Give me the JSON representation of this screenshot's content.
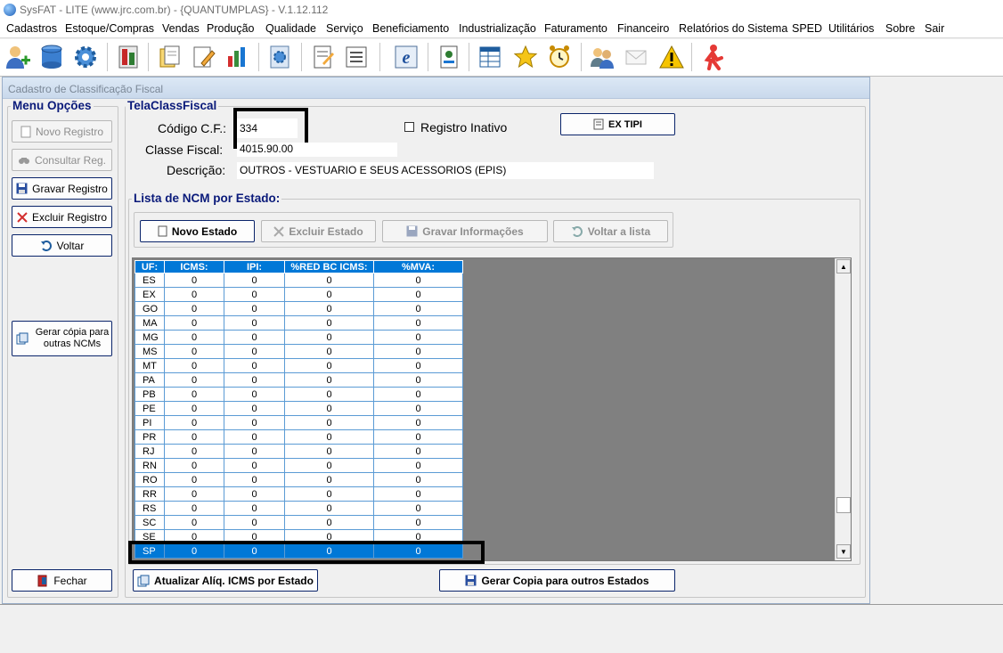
{
  "window": {
    "title": "SysFAT - LITE (www.jrc.com.br) - {QUANTUMPLAS} - V.1.12.112"
  },
  "menu": [
    "Cadastros",
    "Estoque/Compras",
    "Vendas",
    "Produção",
    "Qualidade",
    "Serviço",
    "Beneficiamento",
    "Industrialização",
    "Faturamento",
    "Financeiro",
    "Relatórios do Sistema",
    "SPED",
    "Utilitários",
    "Sobre",
    "Sair"
  ],
  "toolbar": [
    "users-add-icon",
    "database-icon",
    "gear-icon",
    "calculator-icon",
    "documents-icon",
    "edit-doc-icon",
    "chart-icon",
    "settings-doc-icon",
    "notes-icon",
    "list-icon",
    "nfe-icon",
    "report-icon",
    "spreadsheet-icon",
    "star-icon",
    "alarm-icon",
    "chat-users-icon",
    "mail-icon",
    "warning-icon",
    "exit-icon"
  ],
  "child": {
    "title": "Cadastro de Classificação Fiscal"
  },
  "menu_opcoes": {
    "label": "Menu Opções",
    "novo": "Novo Registro",
    "consultar": "Consultar Reg.",
    "gravar": "Gravar Registro",
    "excluir": "Excluir Registro",
    "voltar": "Voltar",
    "gerar_copia_1": "Gerar cópia para",
    "gerar_copia_2": "outras NCMs",
    "fechar": "Fechar"
  },
  "form": {
    "group_label": "TelaClassFiscal",
    "codigo_label": "Código C.F.:",
    "codigo_value": "334",
    "classe_label": "Classe Fiscal:",
    "classe_value": "4015.90.00",
    "descricao_label": "Descrição:",
    "descricao_value": "OUTROS - VESTUARIO E SEUS ACESSORIOS (EPIS)",
    "inativo_label": "Registro Inativo",
    "ex_tipi": "EX TIPI"
  },
  "lista": {
    "label": "Lista de NCM por Estado:",
    "novo_estado": "Novo Estado",
    "excluir_estado": "Excluir Estado",
    "gravar_info": "Gravar Informações",
    "voltar_lista": "Voltar a lista"
  },
  "table": {
    "headers": [
      "UF:",
      "ICMS:",
      "IPI:",
      "%RED BC ICMS:",
      "%MVA:"
    ],
    "rows": [
      [
        "ES",
        "0",
        "0",
        "0",
        "0"
      ],
      [
        "EX",
        "0",
        "0",
        "0",
        "0"
      ],
      [
        "GO",
        "0",
        "0",
        "0",
        "0"
      ],
      [
        "MA",
        "0",
        "0",
        "0",
        "0"
      ],
      [
        "MG",
        "0",
        "0",
        "0",
        "0"
      ],
      [
        "MS",
        "0",
        "0",
        "0",
        "0"
      ],
      [
        "MT",
        "0",
        "0",
        "0",
        "0"
      ],
      [
        "PA",
        "0",
        "0",
        "0",
        "0"
      ],
      [
        "PB",
        "0",
        "0",
        "0",
        "0"
      ],
      [
        "PE",
        "0",
        "0",
        "0",
        "0"
      ],
      [
        "PI",
        "0",
        "0",
        "0",
        "0"
      ],
      [
        "PR",
        "0",
        "0",
        "0",
        "0"
      ],
      [
        "RJ",
        "0",
        "0",
        "0",
        "0"
      ],
      [
        "RN",
        "0",
        "0",
        "0",
        "0"
      ],
      [
        "RO",
        "0",
        "0",
        "0",
        "0"
      ],
      [
        "RR",
        "0",
        "0",
        "0",
        "0"
      ],
      [
        "RS",
        "0",
        "0",
        "0",
        "0"
      ],
      [
        "SC",
        "0",
        "0",
        "0",
        "0"
      ],
      [
        "SE",
        "0",
        "0",
        "0",
        "0"
      ],
      [
        "SP",
        "0",
        "0",
        "0",
        "0"
      ]
    ],
    "selected_uf": "SP"
  },
  "bottom": {
    "atualizar": "Atualizar Alíq. ICMS por Estado",
    "gerar_copia_estados": "Gerar Copia para outros Estados"
  }
}
